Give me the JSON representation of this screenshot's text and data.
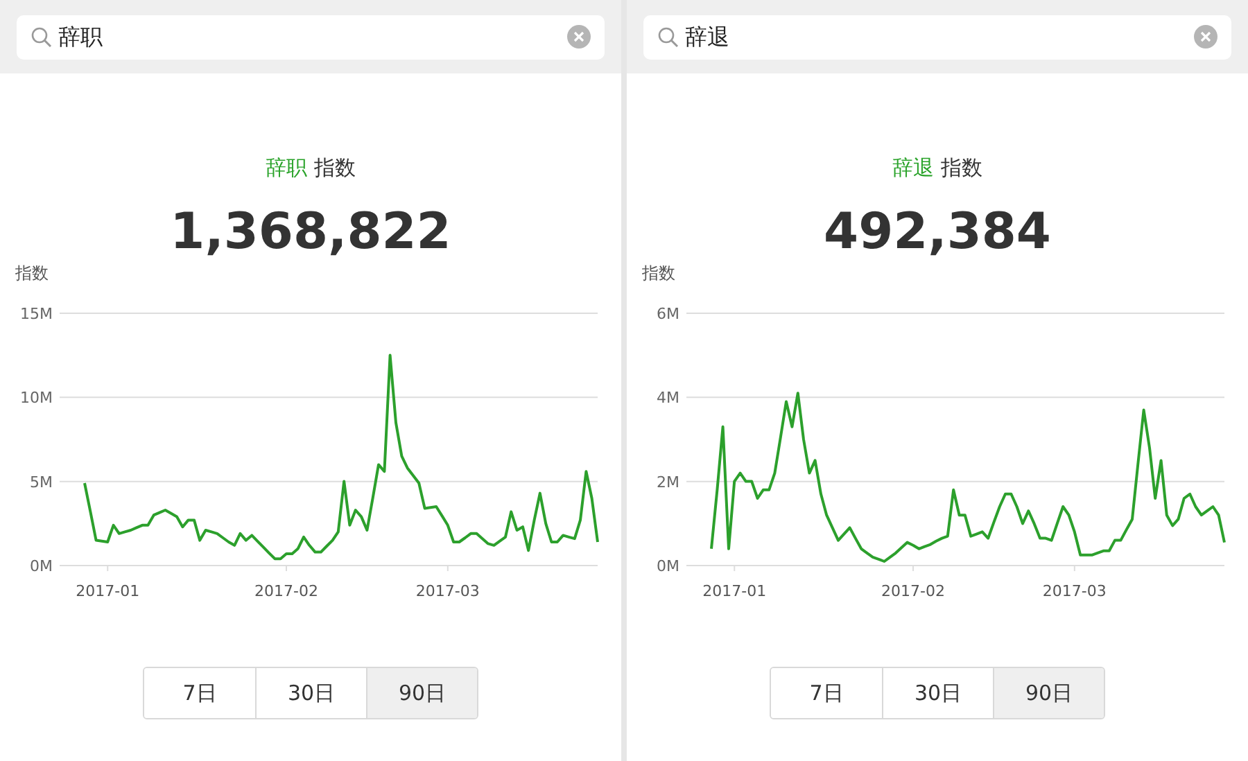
{
  "panels": [
    {
      "search": {
        "value": "辞职"
      },
      "heading": {
        "keyword": "辞职",
        "suffix": "指数"
      },
      "total": "1,368,822",
      "chart_data": {
        "type": "line",
        "ylabel": "指数",
        "ylim": [
          0,
          15
        ],
        "yticks": [
          {
            "value": 0,
            "label": "0M"
          },
          {
            "value": 5,
            "label": "5M"
          },
          {
            "value": 10,
            "label": "10M"
          },
          {
            "value": 15,
            "label": "15M"
          }
        ],
        "categories": [
          null,
          null,
          null,
          null,
          "2017-01",
          null,
          null,
          null,
          null,
          null,
          null,
          null,
          null,
          null,
          null,
          null,
          null,
          null,
          null,
          null,
          null,
          null,
          null,
          null,
          null,
          null,
          null,
          null,
          null,
          null,
          null,
          null,
          null,
          null,
          null,
          "2017-02",
          null,
          null,
          null,
          null,
          null,
          null,
          null,
          null,
          null,
          null,
          null,
          null,
          null,
          null,
          null,
          null,
          null,
          null,
          null,
          null,
          null,
          null,
          null,
          null,
          null,
          null,
          null,
          "2017-03",
          null,
          null,
          null,
          null,
          null,
          null,
          null,
          null,
          null,
          null,
          null,
          null,
          null,
          null,
          null,
          null,
          null,
          null,
          null,
          null,
          null,
          null,
          null,
          null,
          null,
          null
        ],
        "series": [
          {
            "color": "#2ca02c",
            "values": [
              4.9,
              3.2,
              1.5,
              1.45,
              1.4,
              2.4,
              1.9,
              2.0,
              2.1,
              2.25,
              2.4,
              2.4,
              3.0,
              3.15,
              3.3,
              3.1,
              2.9,
              2.3,
              2.7,
              2.7,
              1.5,
              2.1,
              2.0,
              1.9,
              1.65,
              1.4,
              1.2,
              1.9,
              1.5,
              1.8,
              1.45,
              1.1,
              0.75,
              0.4,
              0.4,
              0.7,
              0.7,
              1.0,
              1.7,
              1.2,
              0.8,
              0.8,
              1.15,
              1.5,
              2.0,
              5.0,
              2.4,
              3.3,
              2.9,
              2.1,
              4.05,
              6.0,
              5.6,
              12.5,
              8.5,
              6.5,
              5.8,
              5.35,
              4.9,
              3.4,
              3.45,
              3.5,
              2.95,
              2.4,
              1.4,
              1.4,
              1.65,
              1.9,
              1.9,
              1.6,
              1.3,
              1.2,
              1.45,
              1.7,
              3.2,
              2.1,
              2.3,
              0.9,
              2.7,
              4.3,
              2.5,
              1.4,
              1.4,
              1.8,
              1.7,
              1.6,
              2.7,
              5.6,
              4.0,
              1.4
            ]
          }
        ]
      },
      "ranges": [
        {
          "label": "7日",
          "selected": false
        },
        {
          "label": "30日",
          "selected": false
        },
        {
          "label": "90日",
          "selected": true
        }
      ]
    },
    {
      "search": {
        "value": "辞退"
      },
      "heading": {
        "keyword": "辞退",
        "suffix": "指数"
      },
      "total": "492,384",
      "chart_data": {
        "type": "line",
        "ylabel": "指数",
        "ylim": [
          0,
          6
        ],
        "yticks": [
          {
            "value": 0,
            "label": "0M"
          },
          {
            "value": 2,
            "label": "2M"
          },
          {
            "value": 4,
            "label": "4M"
          },
          {
            "value": 6,
            "label": "6M"
          }
        ],
        "categories": [
          null,
          null,
          null,
          null,
          "2017-01",
          null,
          null,
          null,
          null,
          null,
          null,
          null,
          null,
          null,
          null,
          null,
          null,
          null,
          null,
          null,
          null,
          null,
          null,
          null,
          null,
          null,
          null,
          null,
          null,
          null,
          null,
          null,
          null,
          null,
          null,
          "2017-02",
          null,
          null,
          null,
          null,
          null,
          null,
          null,
          null,
          null,
          null,
          null,
          null,
          null,
          null,
          null,
          null,
          null,
          null,
          null,
          null,
          null,
          null,
          null,
          null,
          null,
          null,
          null,
          "2017-03",
          null,
          null,
          null,
          null,
          null,
          null,
          null,
          null,
          null,
          null,
          null,
          null,
          null,
          null,
          null,
          null,
          null,
          null,
          null,
          null,
          null,
          null,
          null,
          null,
          null,
          null
        ],
        "series": [
          {
            "color": "#2ca02c",
            "values": [
              0.4,
              1.8,
              3.3,
              0.4,
              2.0,
              2.2,
              2.0,
              2.0,
              1.6,
              1.8,
              1.8,
              2.2,
              3.05,
              3.9,
              3.3,
              4.1,
              3.0,
              2.2,
              2.5,
              1.7,
              1.2,
              0.9,
              0.6,
              0.75,
              0.9,
              0.65,
              0.4,
              0.3,
              0.2,
              0.15,
              0.1,
              0.2,
              0.3,
              0.43,
              0.55,
              0.48,
              0.4,
              0.45,
              0.5,
              0.58,
              0.65,
              0.7,
              1.8,
              1.2,
              1.2,
              0.7,
              0.75,
              0.8,
              0.65,
              1.03,
              1.4,
              1.7,
              1.7,
              1.4,
              1.0,
              1.3,
              1.0,
              0.65,
              0.65,
              0.6,
              1.0,
              1.4,
              1.2,
              0.8,
              0.25,
              0.25,
              0.25,
              0.3,
              0.35,
              0.35,
              0.6,
              0.6,
              0.85,
              1.1,
              2.4,
              3.7,
              2.8,
              1.6,
              2.5,
              1.2,
              0.95,
              1.1,
              1.6,
              1.7,
              1.4,
              1.2,
              1.3,
              1.4,
              1.2,
              0.55
            ]
          }
        ]
      },
      "ranges": [
        {
          "label": "7日",
          "selected": false
        },
        {
          "label": "30日",
          "selected": false
        },
        {
          "label": "90日",
          "selected": true
        }
      ]
    }
  ]
}
